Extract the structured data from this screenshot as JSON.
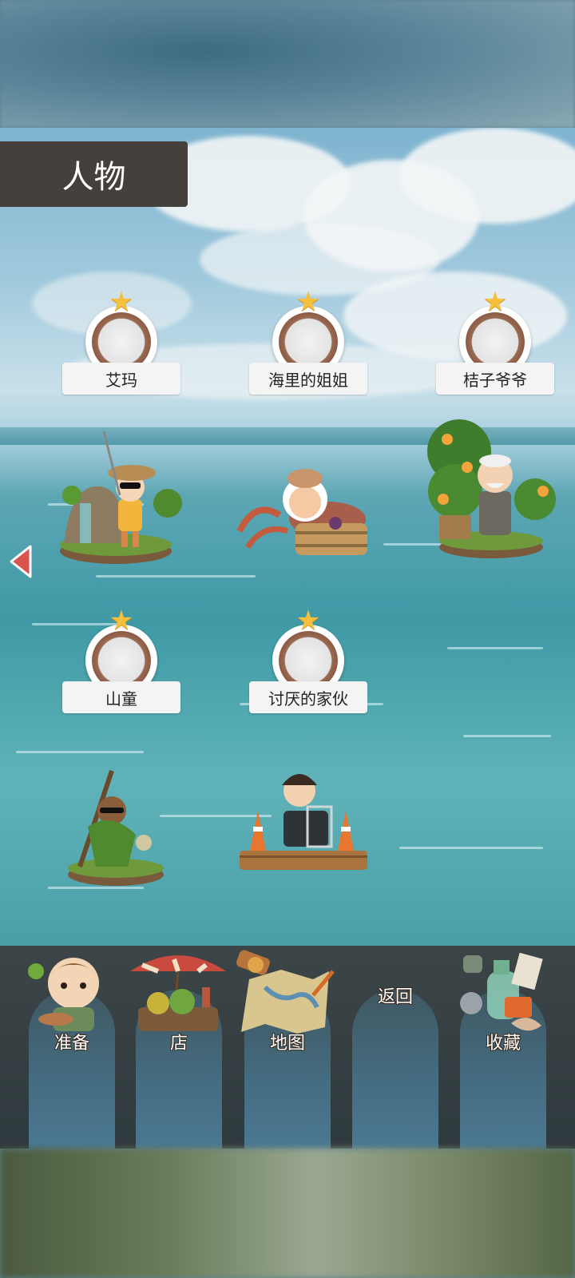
{
  "header": {
    "title": "人物"
  },
  "characters": [
    {
      "name": "艾玛",
      "icon": "emma-character-icon"
    },
    {
      "name": "海里的姐姐",
      "icon": "sea-sister-character-icon"
    },
    {
      "name": "桔子爷爷",
      "icon": "orange-grandpa-character-icon"
    },
    {
      "name": "山童",
      "icon": "mountain-boy-character-icon"
    },
    {
      "name": "讨厌的家伙",
      "icon": "annoying-guy-character-icon"
    }
  ],
  "navigation": {
    "items": [
      {
        "label": "准备",
        "icon": "boy-with-fish-icon"
      },
      {
        "label": "店",
        "icon": "shop-umbrella-stall-icon"
      },
      {
        "label": "地图",
        "icon": "map-and-telescope-icon"
      },
      {
        "label": "返回",
        "icon": ""
      },
      {
        "label": "收藏",
        "icon": "collection-bottles-icon"
      }
    ]
  },
  "colors": {
    "title_bg": "#45403b",
    "nav_bg": "#2f3a3e",
    "nav_button": "#456d82",
    "star": "#f5c03d",
    "badge_ring": "#8d5b45",
    "arrow": "#d9534f"
  }
}
